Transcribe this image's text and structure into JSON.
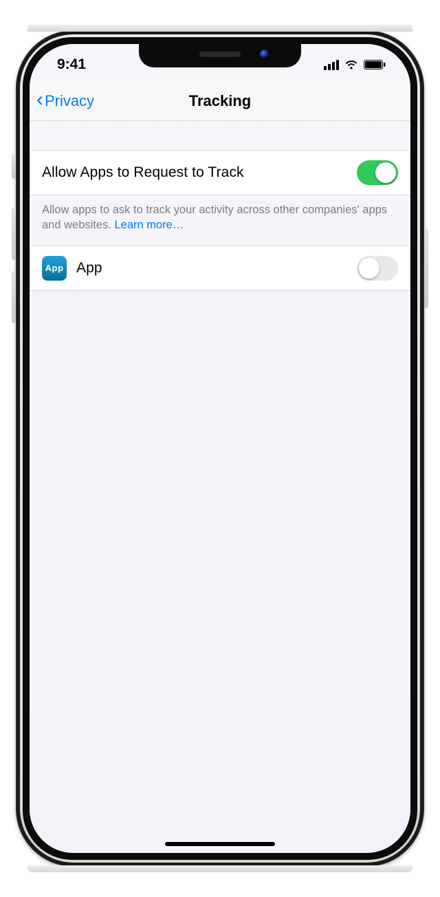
{
  "status": {
    "time": "9:41"
  },
  "nav": {
    "back_label": "Privacy",
    "title": "Tracking"
  },
  "settings": {
    "allow_tracking": {
      "label": "Allow Apps to Request to Track",
      "on": true
    },
    "footer_text": "Allow apps to ask to track your activity across other companies' apps and websites. ",
    "learn_more_label": "Learn more…"
  },
  "apps": [
    {
      "icon_text": "App",
      "name": "App",
      "on": false
    }
  ]
}
